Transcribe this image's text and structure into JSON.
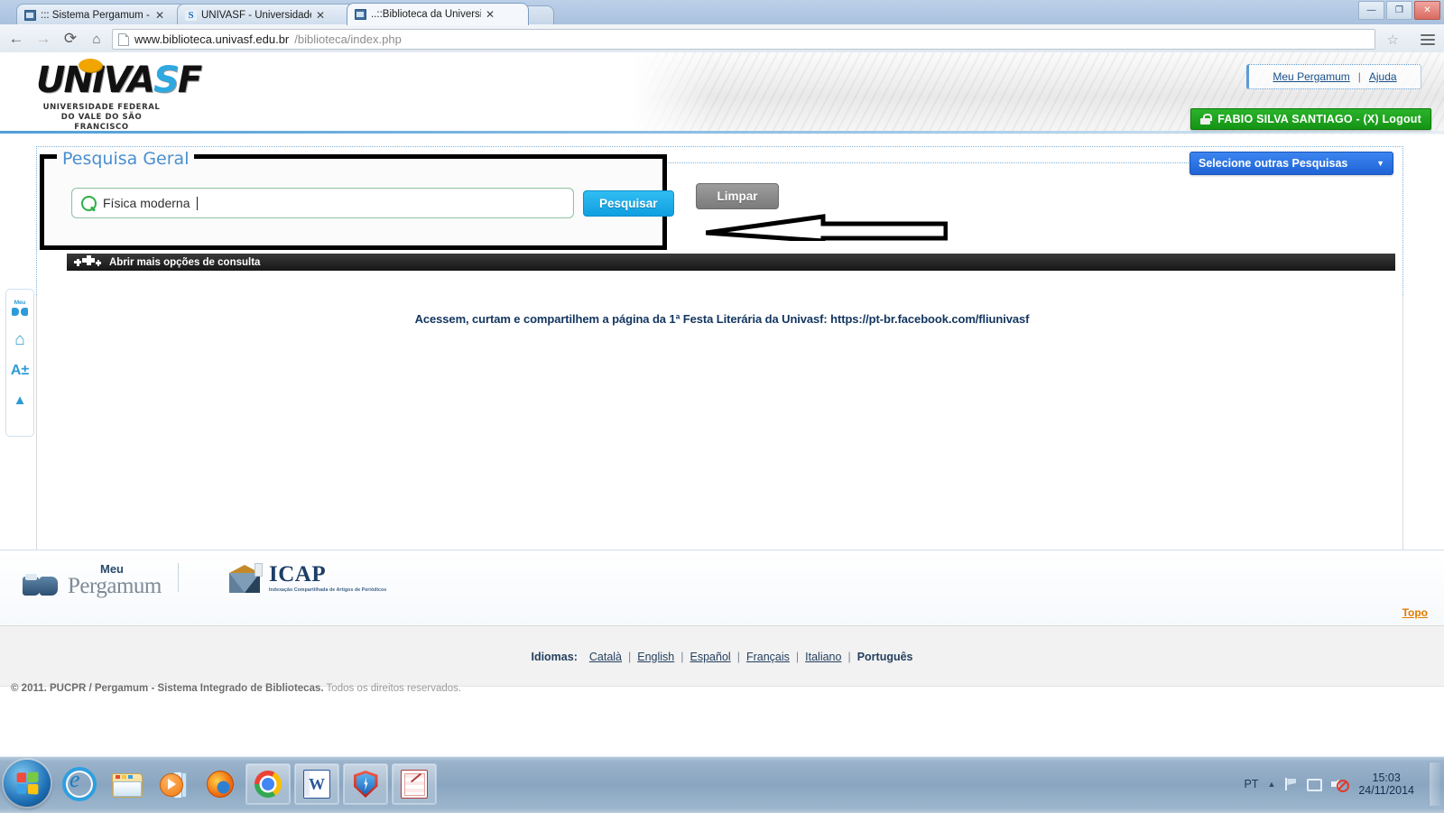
{
  "browser": {
    "tabs": [
      {
        "title": "::: Sistema Pergamum - Lo",
        "favicon": "pergamum-icon",
        "active": false
      },
      {
        "title": "UNIVASF - Universidade F",
        "favicon": "univasf-icon",
        "active": false
      },
      {
        "title": "..::Biblioteca da Universida",
        "favicon": "pergamum-icon",
        "active": true
      }
    ],
    "window_controls": {
      "minimize": "—",
      "maximize": "❐",
      "close": "✕"
    },
    "nav": {
      "back": "←",
      "forward": "→",
      "reload": "⟳",
      "home": "⌂"
    },
    "url": {
      "host": "www.biblioteca.univasf.edu.br",
      "path": "/biblioteca/index.php"
    },
    "bookmark_star": "☆"
  },
  "site": {
    "logo": {
      "word": "UNIVA",
      "word_s": "S",
      "word_f": "F",
      "sub_line1": "UNIVERSIDADE FEDERAL",
      "sub_line2": "DO VALE DO SÃO FRANCISCO"
    },
    "userbox": {
      "meu_pergamum": "Meu Pergamum",
      "separator": "|",
      "ajuda": "Ajuda"
    },
    "login_bar": {
      "label": "FABIO SILVA SANTIAGO - (X) Logout",
      "color": "#149414"
    }
  },
  "search_panel": {
    "title": "Pesquisa Geral",
    "input_value": "Física moderna",
    "input_placeholder": "",
    "search_button": "Pesquisar",
    "clear_button": "Limpar",
    "other_searches_dropdown": "Selecione outras Pesquisas",
    "dropdown_caret": "▼",
    "more_options_bar": "Abrir mais opções de consulta"
  },
  "content": {
    "notice": "Acessem, curtam e compartilhem a página da 1ª Festa Literária da Univasf: https://pt-br.facebook.com/fliunivasf"
  },
  "rail": {
    "meu_label": "Meu",
    "items": [
      "meu-pergamum-icon",
      "home-icon",
      "font-size-icon",
      "scroll-up-icon"
    ],
    "font_size_label": "A±",
    "home_glyph": "⌂",
    "up_glyph": "▲"
  },
  "footer": {
    "pergamum_logo": {
      "meu": "Meu",
      "name": "Pergamum"
    },
    "icap_logo": {
      "name": "ICAP",
      "subtitle": "Indexação Compartilhada de Artigos de Periódicos"
    },
    "topo_link": "Topo",
    "languages_label": "Idiomas:",
    "languages": [
      "Català",
      "English",
      "Español",
      "Français",
      "Italiano",
      "Português"
    ],
    "current_language": "Português",
    "copyright_bold": "© 2011. PUCPR / Pergamum - Sistema Integrado de Bibliotecas.",
    "copyright_rest": " Todos os direitos reservados."
  },
  "taskbar": {
    "start": "windows-start-orb",
    "apps": [
      "internet-explorer-icon",
      "file-explorer-icon",
      "windows-media-player-icon",
      "firefox-icon",
      "chrome-icon",
      "word-icon",
      "security-shield-icon",
      "image-editor-icon"
    ],
    "tray": {
      "language": "PT",
      "chevron": "▲",
      "time": "15:03",
      "date": "24/11/2014"
    }
  }
}
